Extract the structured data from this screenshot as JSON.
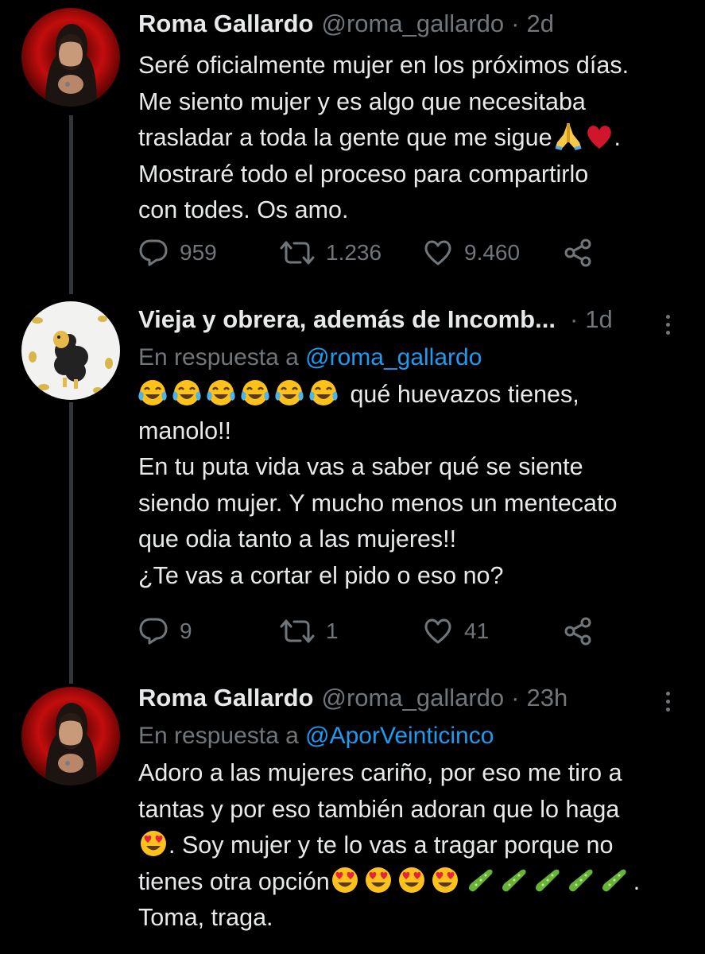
{
  "tweets": [
    {
      "name": "Roma Gallardo",
      "handle": "@roma_gallardo",
      "time": "2d",
      "reply_to_prefix": "",
      "reply_to_mention": "",
      "lines": [
        "Seré oficialmente mujer en los próximos días.",
        "Me siento mujer y es algo que necesitaba",
        "trasladar a toda la gente que me sigue",
        "Mostraré todo el proceso para compartirlo",
        "con todes. Os amo."
      ],
      "line3_suffix": ".",
      "replies": "959",
      "retweets": "1.236",
      "likes": "9.460"
    },
    {
      "name": "Vieja y obrera, además de Incomb...",
      "handle": "",
      "time": "1d",
      "reply_to_prefix": "En respuesta a ",
      "reply_to_mention": "@roma_gallardo",
      "line1_suffix": " qué huevazos tienes,",
      "lines": [
        "manolo!!",
        "En tu puta vida vas a saber qué se siente",
        "siendo mujer. Y mucho menos un mentecato",
        "que odia tanto a las mujeres!!",
        "¿Te vas a cortar el pido o eso no?"
      ],
      "replies": "9",
      "retweets": "1",
      "likes": "41"
    },
    {
      "name": "Roma Gallardo",
      "handle": "@roma_gallardo",
      "time": "23h",
      "reply_to_prefix": "En respuesta a ",
      "reply_to_mention": "@AporVeinticinco",
      "lines": [
        "Adoro a las mujeres cariño, por eso me tiro a",
        "tantas y por eso también adoran que lo haga",
        ". Soy mujer y te lo vas a tragar porque no",
        "tienes otra opción",
        "Toma, traga."
      ],
      "line4_suffix": "."
    }
  ],
  "dot": "·",
  "icons": [
    "reply-icon",
    "retweet-icon",
    "like-icon",
    "share-icon",
    "more-icon"
  ],
  "colors": {
    "background": "#000000",
    "text": "#e7e9ea",
    "muted": "#71767b",
    "link": "#1d9bf0"
  }
}
